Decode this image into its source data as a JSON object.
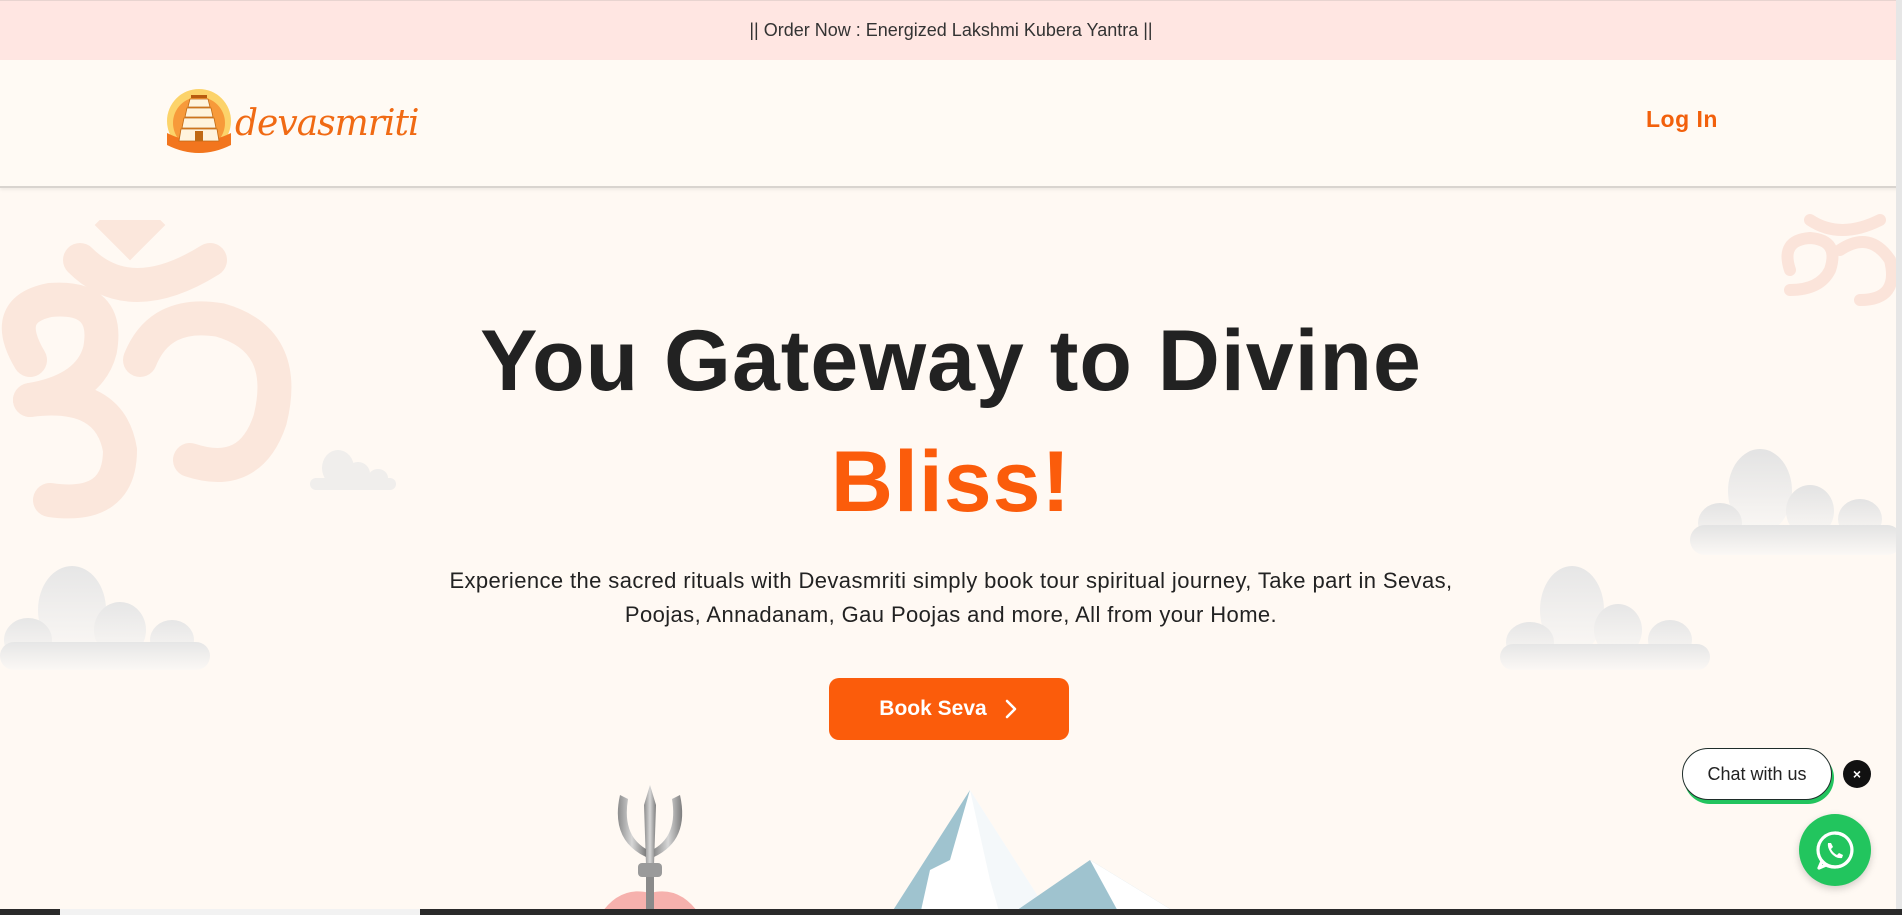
{
  "banner": {
    "text": "|| Order Now : Energized Lakshmi Kubera Yantra ||"
  },
  "header": {
    "logo_text": "devasmriti",
    "login_label": "Log In"
  },
  "hero": {
    "title_line1": "You Gateway to Divine",
    "title_line2": "Bliss!",
    "subtitle": "Experience the sacred rituals with Devasmriti simply book tour spiritual journey, Take part in Sevas, Poojas, Annadanam, Gau Poojas and more, All from your Home.",
    "cta_label": "Book Seva"
  },
  "chat": {
    "pill_label": "Chat with us",
    "close_glyph": "×"
  },
  "colors": {
    "accent": "#fb5c0b",
    "banner_bg": "#ffe6e2",
    "page_bg": "#fff9f3",
    "whatsapp": "#22c55e"
  },
  "icons": {
    "logo": "temple-gopuram-sun-icon",
    "cta_arrow": "chevron-right-icon",
    "whatsapp": "whatsapp-icon",
    "close": "close-icon"
  }
}
